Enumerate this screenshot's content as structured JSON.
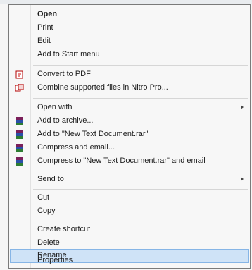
{
  "menu": {
    "items": [
      {
        "label": "Open",
        "icon": null
      },
      {
        "label": "Print",
        "icon": null
      },
      {
        "label": "Edit",
        "icon": null
      },
      {
        "label": "Add to Start menu",
        "icon": null
      },
      {
        "label": "Convert to PDF",
        "icon": "pdf-icon"
      },
      {
        "label": "Combine supported files in Nitro Pro...",
        "icon": "nitro-combine-icon"
      },
      {
        "label": "Open with",
        "icon": null
      },
      {
        "label": "Add to archive...",
        "icon": "winrar-icon"
      },
      {
        "label": "Add to \"New Text Document.rar\"",
        "icon": "winrar-icon"
      },
      {
        "label": "Compress and email...",
        "icon": "winrar-icon"
      },
      {
        "label": "Compress to \"New Text Document.rar\" and email",
        "icon": "winrar-icon"
      },
      {
        "label": "Send to",
        "icon": null
      },
      {
        "label": "Cut",
        "icon": null
      },
      {
        "label": "Copy",
        "icon": null
      },
      {
        "label": "Create shortcut",
        "icon": null
      },
      {
        "label": "Delete",
        "icon": null
      },
      {
        "label": "Rename",
        "icon": null
      },
      {
        "label": "Properties",
        "icon": null
      }
    ]
  },
  "colors": {
    "highlight_bg": "#cfe3f7",
    "highlight_border": "#86b5e6",
    "text": "#1c1c1c"
  }
}
